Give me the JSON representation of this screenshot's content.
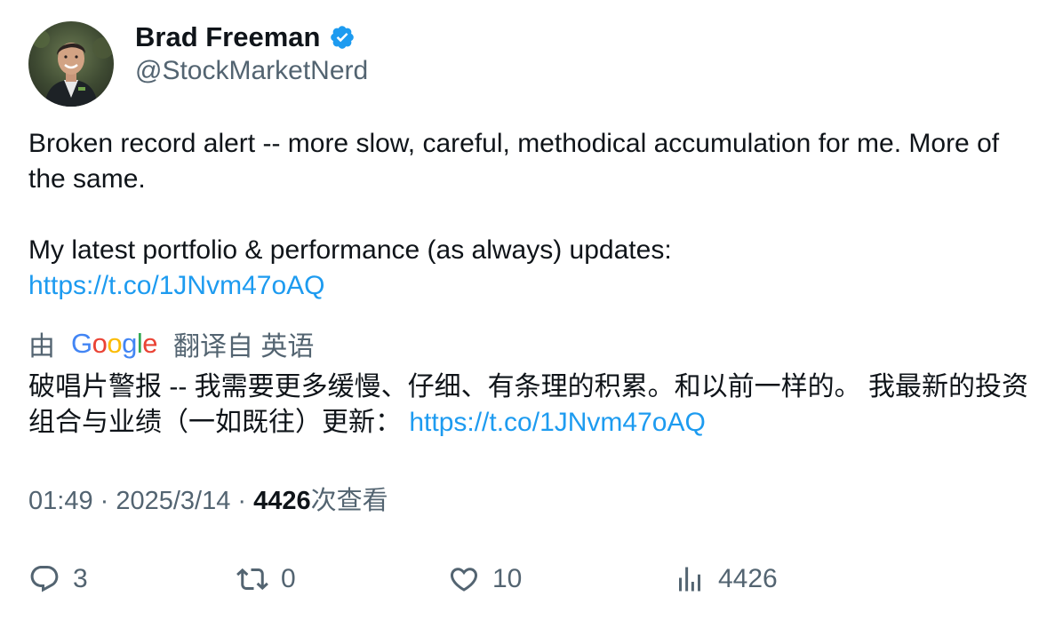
{
  "author": {
    "name": "Brad Freeman",
    "handle": "@StockMarketNerd",
    "verified_color": "#1d9bf0"
  },
  "tweet": {
    "line1": "Broken record alert -- more slow, careful, methodical accumulation for me. More of the same.",
    "line2": "My latest portfolio & performance (as always) updates:",
    "link": "https://t.co/1JNvm47oAQ"
  },
  "translation": {
    "prefix": "由",
    "logo_letters": [
      "G",
      "o",
      "o",
      "g",
      "l",
      "e"
    ],
    "logo_colors": [
      "#4285f4",
      "#ea4335",
      "#fbbc05",
      "#4285f4",
      "#34a853",
      "#ea4335"
    ],
    "suffix": "翻译自 英语",
    "text": "破唱片警报 -- 我需要更多缓慢、仔细、有条理的积累。和以前一样的。 我最新的投资组合与业绩（一如既往）更新：",
    "link": "https://t.co/1JNvm47oAQ"
  },
  "meta": {
    "time": "01:49",
    "sep1": " · ",
    "date": "2025/3/14",
    "sep2": " · ",
    "views_count": "4426",
    "views_label": "次查看"
  },
  "actions": {
    "replies": "3",
    "retweets": "0",
    "likes": "10",
    "views": "4426"
  },
  "icons": {
    "verified": "verified-badge-icon",
    "reply": "reply-icon",
    "retweet": "retweet-icon",
    "like": "heart-icon",
    "views": "bar-chart-icon"
  }
}
